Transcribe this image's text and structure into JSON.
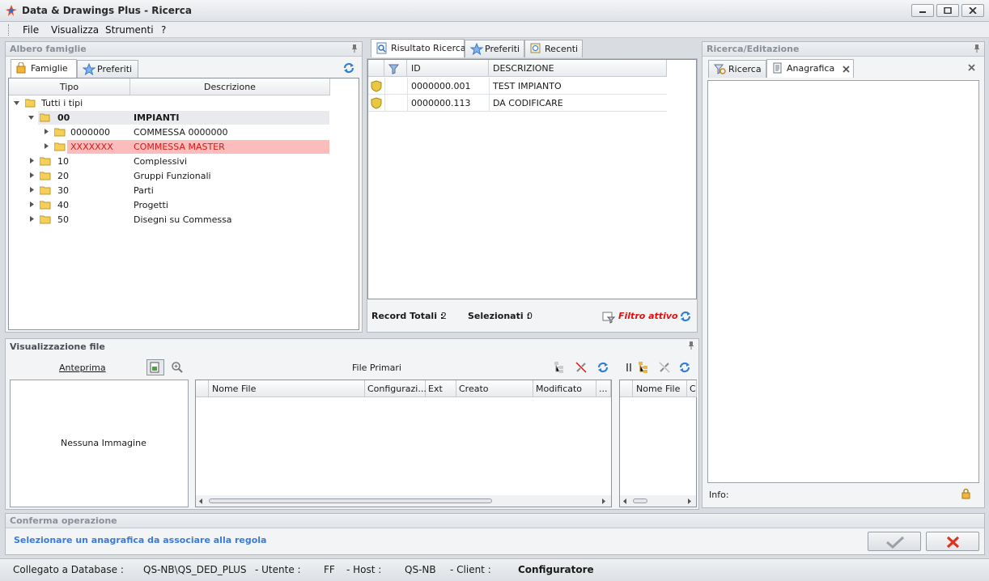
{
  "window": {
    "title": "Data & Drawings Plus - Ricerca"
  },
  "menu": [
    "File",
    "Visualizza",
    "Strumenti",
    "?"
  ],
  "families_panel": {
    "title": "Albero famiglie",
    "tabs": [
      "Famiglie",
      "Preferiti"
    ],
    "columns": [
      "Tipo",
      "Descrizione"
    ],
    "tree": [
      {
        "code": "Tutti i tipi",
        "desc": ""
      },
      {
        "code": "00",
        "desc": "IMPIANTI"
      },
      {
        "code": "0000000",
        "desc": "COMMESSA 0000000"
      },
      {
        "code": "XXXXXXX",
        "desc": "COMMESSA MASTER"
      },
      {
        "code": "10",
        "desc": "Complessivi"
      },
      {
        "code": "20",
        "desc": "Gruppi Funzionali"
      },
      {
        "code": "30",
        "desc": "Parti"
      },
      {
        "code": "40",
        "desc": "Progetti"
      },
      {
        "code": "50",
        "desc": "Disegni su Commessa"
      }
    ]
  },
  "results_panel": {
    "tabs": [
      "Risultato Ricerca",
      "Preferiti",
      "Recenti"
    ],
    "columns": [
      "ID",
      "DESCRIZIONE"
    ],
    "rows": [
      {
        "id": "0000000.001",
        "desc": "TEST IMPIANTO"
      },
      {
        "id": "0000000.113",
        "desc": "DA CODIFICARE"
      }
    ],
    "footer": {
      "total_label": "Record Totali :",
      "total_value": "2",
      "selected_label": "Selezionati :",
      "selected_value": "0",
      "filter_label": "Filtro attivo"
    }
  },
  "edit_panel": {
    "title": "Ricerca/Editazione",
    "tabs": [
      "Ricerca",
      "Anagrafica"
    ],
    "info_label": "Info:"
  },
  "file_panel": {
    "title": "Visualizzazione file",
    "preview_label": "Anteprima",
    "no_image": "Nessuna Immagine",
    "primary_title": "File Primari",
    "columns": [
      "Nome File",
      "Configurazi...",
      "Ext",
      "Creato",
      "Modificato",
      "..."
    ],
    "secondary_columns": [
      "Nome File",
      "C"
    ]
  },
  "confirm_panel": {
    "title": "Conferma operazione",
    "message": "Selezionare un anagrafica da associare alla regola"
  },
  "status": {
    "db_label": "Collegato a Database :",
    "db_value": "QS-NB\\QS_DED_PLUS",
    "user_label": "- Utente :",
    "user_value": "FF",
    "host_label": "- Host :",
    "host_value": "QS-NB",
    "client_label": "- Client :",
    "client_value": "Configuratore"
  },
  "colors": {
    "accent_blue": "#3a7bd5",
    "filter_red": "#e01010",
    "highlight_row": "#fbbcbc",
    "cancel_red": "#e2311b"
  }
}
